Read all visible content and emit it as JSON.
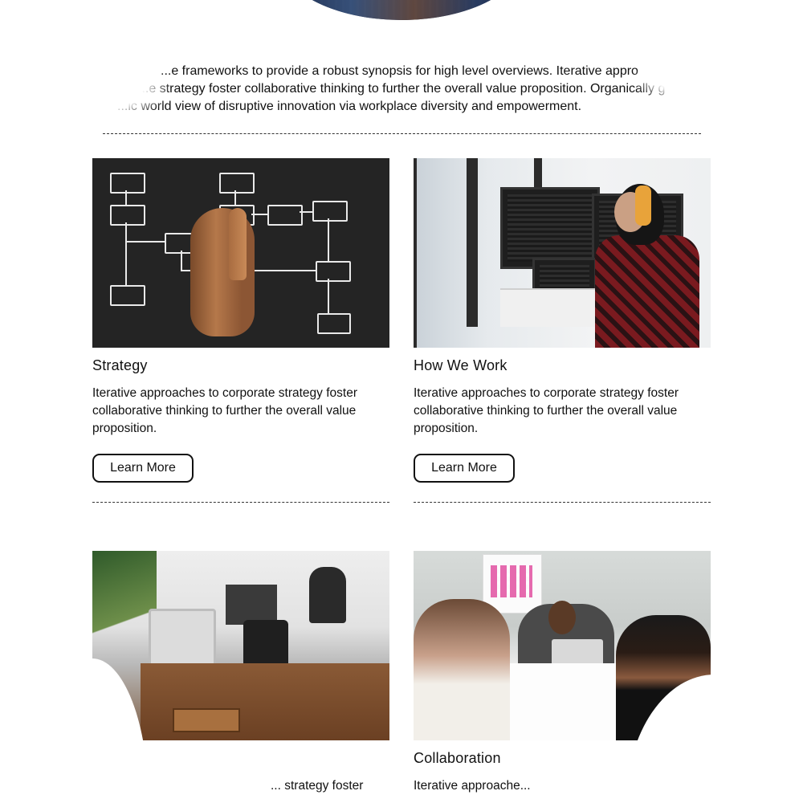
{
  "intro": {
    "line1": "...e frameworks to provide a robust synopsis for high level overviews. Iterative appro",
    "line2": "...e strategy foster collaborative thinking to further the overall value proposition. Organically g",
    "line3": "...ic world view of disruptive innovation via workplace diversity and empowerment."
  },
  "cards": [
    {
      "title": "Strategy",
      "desc": "Iterative approaches to corporate strategy foster collaborative thinking to further the overall value proposition.",
      "button": "Learn More",
      "image": "flowchart-chalkboard-image"
    },
    {
      "title": "How We Work",
      "desc": "Iterative approaches to corporate strategy foster collaborative thinking to further the overall value proposition.",
      "button": "Learn More",
      "image": "developer-workstation-image"
    },
    {
      "title": "",
      "desc": "... strategy foster",
      "button": "",
      "image": "coworking-office-image"
    },
    {
      "title": "Collaboration",
      "desc": "Iterative approache... ",
      "button": "",
      "image": "team-meeting-image"
    }
  ]
}
